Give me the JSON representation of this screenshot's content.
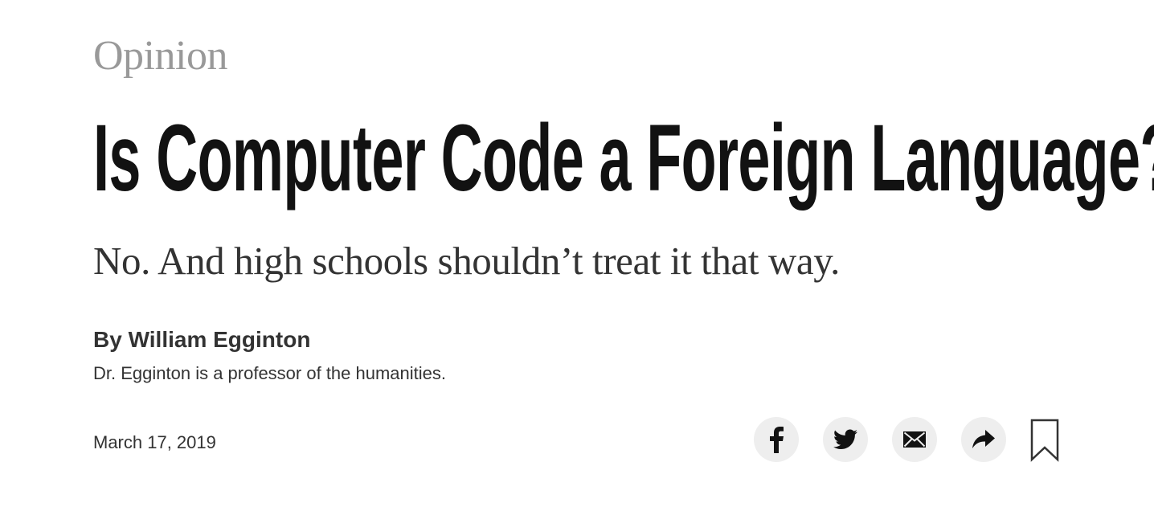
{
  "section": {
    "label": "Opinion"
  },
  "article": {
    "headline": "Is Computer Code a Foreign Language?",
    "summary": "No. And high schools shouldn’t treat it that way.",
    "byline": "By William Egginton",
    "author_bio": "Dr. Egginton is a professor of the humanities.",
    "date": "March 17, 2019"
  },
  "share_tools": {
    "buttons": [
      {
        "icon": "facebook-icon"
      },
      {
        "icon": "twitter-icon"
      },
      {
        "icon": "email-icon"
      },
      {
        "icon": "share-arrow-icon"
      },
      {
        "icon": "bookmark-icon"
      }
    ]
  },
  "colors": {
    "section_label": "#999999",
    "headline": "#121212",
    "body_text": "#333333",
    "share_button_bg": "#eeeeee",
    "icon": "#121212"
  }
}
